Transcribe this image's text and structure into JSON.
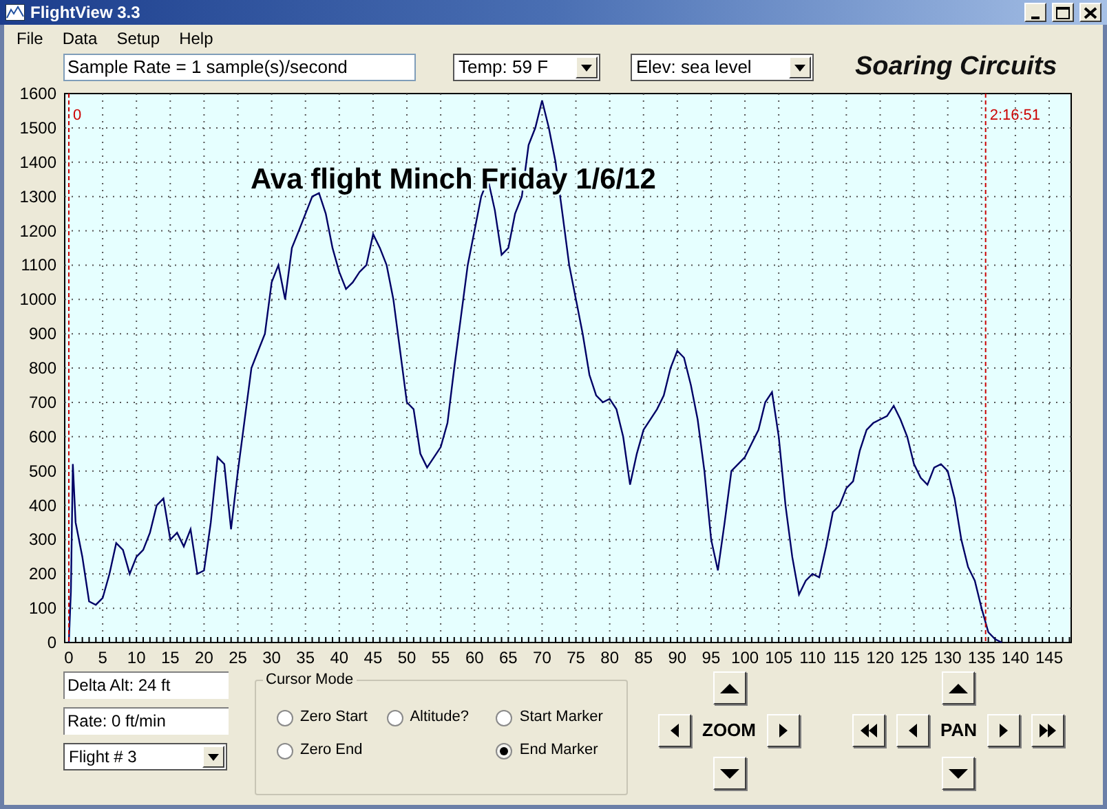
{
  "window": {
    "title": "FlightView 3.3"
  },
  "menu": [
    "File",
    "Data",
    "Setup",
    "Help"
  ],
  "toolbar": {
    "sample_rate": "Sample Rate =  1 sample(s)/second",
    "temp": "Temp:  59 F",
    "elevation": "Elev: sea level",
    "brand": "Soaring Circuits"
  },
  "chart": {
    "chart_data": {
      "type": "line",
      "title": "Ava flight Minch Friday 1/6/12",
      "xlim": [
        0,
        148
      ],
      "ylim": [
        0,
        1600
      ],
      "xticks": [
        0,
        5,
        10,
        15,
        20,
        25,
        30,
        35,
        40,
        45,
        50,
        55,
        60,
        65,
        70,
        75,
        80,
        85,
        90,
        95,
        100,
        105,
        110,
        115,
        120,
        125,
        130,
        135,
        140,
        145
      ],
      "yticks": [
        0,
        100,
        200,
        300,
        400,
        500,
        600,
        700,
        800,
        900,
        1000,
        1100,
        1200,
        1300,
        1400,
        1500,
        1600
      ],
      "x": [
        0,
        0.3,
        0.6,
        1,
        2,
        3,
        4,
        5,
        6,
        7,
        8,
        9,
        10,
        11,
        12,
        13,
        14,
        15,
        16,
        17,
        18,
        19,
        20,
        21,
        22,
        23,
        24,
        25,
        26,
        27,
        28,
        29,
        30,
        31,
        32,
        33,
        34,
        35,
        36,
        37,
        38,
        39,
        40,
        41,
        42,
        43,
        44,
        45,
        46,
        47,
        48,
        49,
        50,
        51,
        52,
        53,
        54,
        55,
        56,
        57,
        58,
        59,
        60,
        61,
        62,
        63,
        64,
        65,
        66,
        67,
        68,
        69,
        70,
        71,
        72,
        73,
        74,
        75,
        76,
        77,
        78,
        79,
        80,
        81,
        82,
        83,
        84,
        85,
        86,
        87,
        88,
        89,
        90,
        91,
        92,
        93,
        94,
        95,
        96,
        97,
        98,
        99,
        100,
        101,
        102,
        103,
        104,
        105,
        106,
        107,
        108,
        109,
        110,
        111,
        112,
        113,
        114,
        115,
        116,
        117,
        118,
        119,
        120,
        121,
        122,
        123,
        124,
        125,
        126,
        127,
        128,
        129,
        130,
        131,
        132,
        133,
        134,
        135,
        136,
        137,
        138
      ],
      "grid": true,
      "series": [
        {
          "color": "#000066",
          "values": [
            0,
            150,
            520,
            350,
            250,
            120,
            110,
            130,
            200,
            290,
            270,
            200,
            250,
            270,
            320,
            400,
            420,
            300,
            320,
            280,
            330,
            200,
            210,
            350,
            540,
            520,
            330,
            500,
            650,
            800,
            850,
            900,
            1050,
            1100,
            1000,
            1150,
            1200,
            1250,
            1300,
            1310,
            1250,
            1150,
            1080,
            1030,
            1050,
            1080,
            1100,
            1190,
            1150,
            1100,
            1000,
            850,
            700,
            680,
            550,
            510,
            540,
            570,
            640,
            800,
            950,
            1100,
            1200,
            1300,
            1350,
            1260,
            1130,
            1150,
            1250,
            1300,
            1450,
            1500,
            1580,
            1500,
            1400,
            1250,
            1100,
            1000,
            900,
            780,
            720,
            700,
            710,
            680,
            600,
            460,
            550,
            620,
            650,
            680,
            720,
            800,
            850,
            830,
            750,
            650,
            500,
            300,
            210,
            350,
            500,
            520,
            540,
            580,
            620,
            700,
            730,
            600,
            400,
            250,
            140,
            180,
            200,
            190,
            280,
            380,
            400,
            450,
            470,
            560,
            620,
            640,
            650,
            660,
            690,
            650,
            600,
            520,
            480,
            460,
            510,
            520,
            500,
            420,
            300,
            220,
            180,
            100,
            30,
            10,
            0
          ]
        }
      ],
      "ref_lines": [
        {
          "axis": "x",
          "value": 0,
          "color": "#cc0000"
        },
        {
          "axis": "x",
          "value": 135.6,
          "color": "#cc0000"
        }
      ],
      "annotations": [
        {
          "x": 0,
          "y": 1540,
          "text": "0"
        },
        {
          "x": 135.6,
          "y": 1540,
          "text": "2:16:51"
        }
      ]
    }
  },
  "readouts": {
    "delta_alt": "Delta Alt: 24 ft",
    "rate": "Rate: 0 ft/min",
    "flight": "Flight # 3"
  },
  "cursor_mode": {
    "title": "Cursor Mode",
    "columns": [
      [
        {
          "label": "Zero Start",
          "selected": false
        },
        {
          "label": "Zero End",
          "selected": false
        }
      ],
      [
        {
          "label": "Altitude?",
          "selected": false
        }
      ],
      [
        {
          "label": "Start Marker",
          "selected": false
        },
        {
          "label": "End Marker",
          "selected": true
        }
      ]
    ]
  },
  "zoom": {
    "label": "ZOOM"
  },
  "pan": {
    "label": "PAN"
  }
}
